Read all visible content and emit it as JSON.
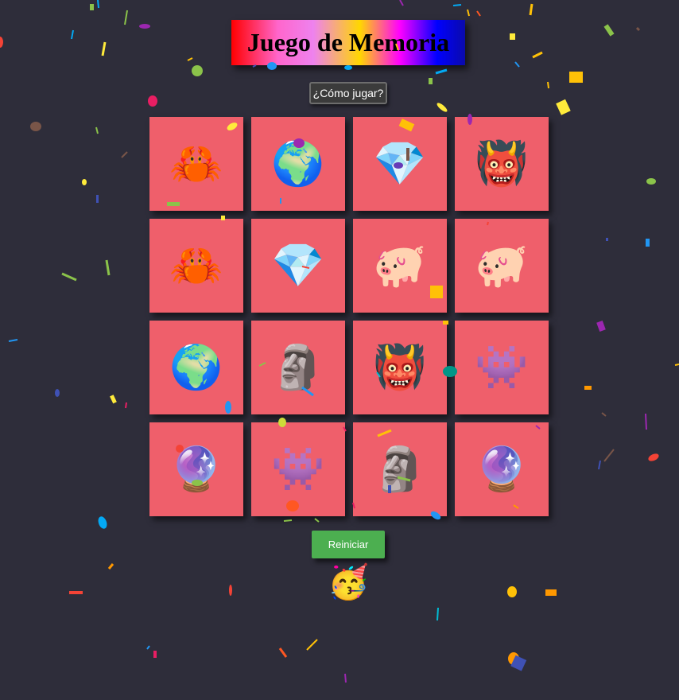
{
  "header": {
    "title": "Juego de Memoria",
    "help_label": "¿Cómo jugar?"
  },
  "board": {
    "cards": [
      {
        "emoji": "🦀",
        "icon": "crab-icon"
      },
      {
        "emoji": "🌍",
        "icon": "globe-icon"
      },
      {
        "emoji": "💎",
        "icon": "diamond-icon"
      },
      {
        "emoji": "👹",
        "icon": "ogre-icon"
      },
      {
        "emoji": "🦀",
        "icon": "crab-icon"
      },
      {
        "emoji": "💎",
        "icon": "diamond-icon"
      },
      {
        "emoji": "🐖",
        "icon": "pig-icon"
      },
      {
        "emoji": "🐖",
        "icon": "pig-icon"
      },
      {
        "emoji": "🌍",
        "icon": "globe-icon"
      },
      {
        "emoji": "🗿",
        "icon": "moai-icon"
      },
      {
        "emoji": "👹",
        "icon": "ogre-icon"
      },
      {
        "emoji": "👾",
        "icon": "alien-monster-icon"
      },
      {
        "emoji": "🔮",
        "icon": "crystal-ball-icon"
      },
      {
        "emoji": "👾",
        "icon": "alien-monster-icon"
      },
      {
        "emoji": "🗿",
        "icon": "moai-icon"
      },
      {
        "emoji": "🔮",
        "icon": "crystal-ball-icon"
      }
    ]
  },
  "controls": {
    "restart_label": "Reiniciar"
  },
  "status": {
    "win_emoji": "🥳",
    "win_icon": "partying-face-icon"
  },
  "colors": {
    "background": "#2e2d3a",
    "card": "#ef5f6b",
    "restart_button": "#4caf50",
    "confetti": [
      "#ffc107",
      "#2196f3",
      "#8bc34a",
      "#9c27b0",
      "#f44336",
      "#673ab7",
      "#009688",
      "#ff5722",
      "#795548",
      "#03a9f4",
      "#cddc39",
      "#e91e63",
      "#3f51b5",
      "#ff9800"
    ]
  }
}
